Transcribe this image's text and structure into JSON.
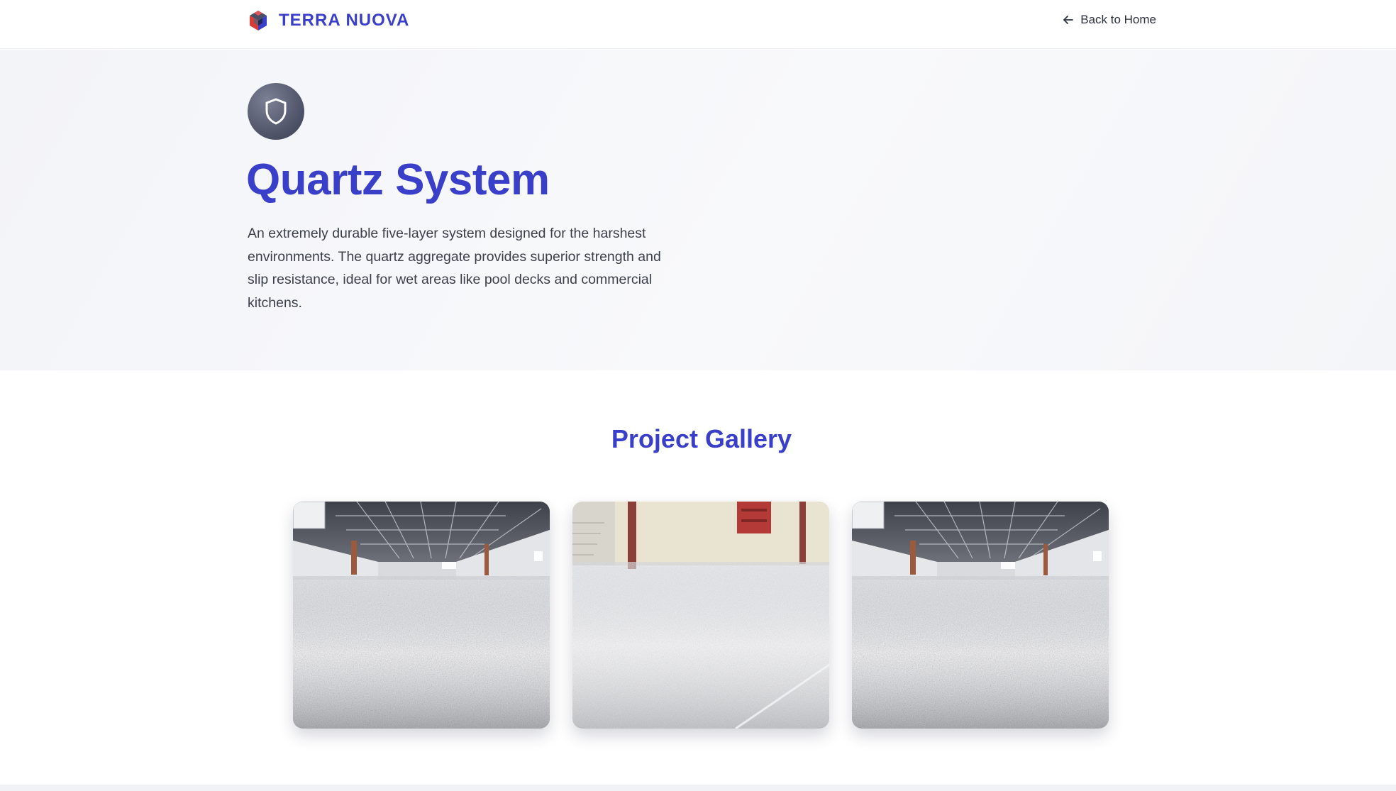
{
  "header": {
    "brand_name": "TERRA NUOVA",
    "logo_icon": "cube-logo-icon",
    "back_label": "Back to Home",
    "back_icon": "arrow-left-icon"
  },
  "hero": {
    "icon": "shield-icon",
    "title": "Quartz System",
    "description": "An extremely durable five-layer system designed for the harshest environments. The quartz aggregate provides superior strength and slip resistance, ideal for wet areas like pool decks and commercial kitchens."
  },
  "gallery": {
    "title": "Project Gallery",
    "images": [
      {
        "subject": "warehouse-floor-photo"
      },
      {
        "subject": "garage-floor-photo"
      },
      {
        "subject": "warehouse-floor-photo"
      }
    ]
  },
  "colors": {
    "accent": "#3a3fc9",
    "text": "#3b3f4a",
    "hero_bg": "#f5f6f9"
  }
}
